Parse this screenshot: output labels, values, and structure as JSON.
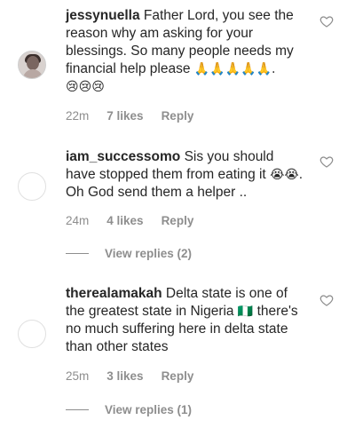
{
  "comments": [
    {
      "username": "jessynuella",
      "text": "Father Lord, you see the reason why am asking for your blessings. So many people needs my financial help please",
      "emoji_tail": "🙏🙏🙏🙏🙏.",
      "emoji_line": "😢😢😢",
      "time": "22m",
      "likes": "7 likes",
      "reply": "Reply"
    },
    {
      "username": "iam_successomo",
      "text": "Sis you should have stopped them from eating it",
      "emoji_tail": "😭😭",
      "text_after": ". Oh God send them a helper ..",
      "time": "24m",
      "likes": "4 likes",
      "reply": "Reply",
      "view_replies": "View replies (2)"
    },
    {
      "username": "therealamakah",
      "text": "Delta state is one of the greatest state in Nigeria",
      "emoji_tail": "🇳🇬",
      "text_after": " there's no much suffering here in delta state than other states",
      "time": "25m",
      "likes": "3 likes",
      "reply": "Reply",
      "view_replies": "View replies (1)"
    }
  ]
}
